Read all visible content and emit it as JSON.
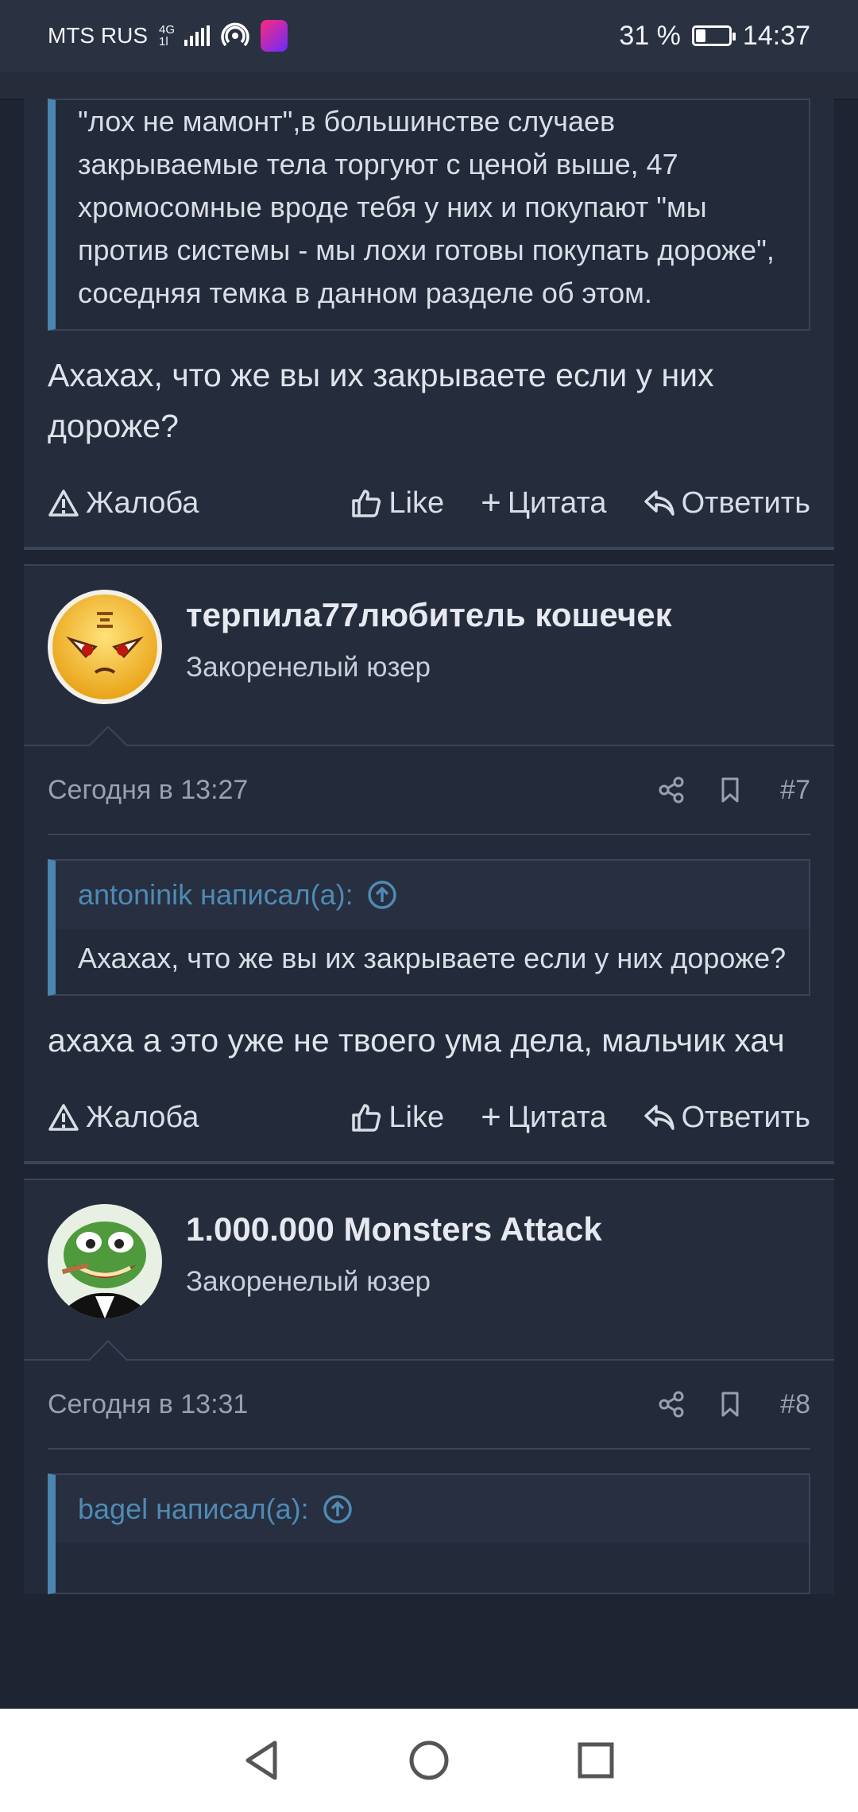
{
  "status_bar": {
    "carrier": "MTS RUS",
    "network_top": "4G",
    "network_bottom": "1l",
    "battery_percent": "31 %",
    "battery_level": 0.31,
    "time": "14:37"
  },
  "posts": [
    {
      "quote_text": "\"лох не мамонт\",в большинстве случаев закрываемые тела торгуют с ценой выше, 47 хромосомные вроде тебя у них и покупают \"мы против системы - мы лохи готовы покупать дороже\", соседняя темка в данном разделе об этом.",
      "text": "Ахахах, что же вы их закрываете если у них дороже?",
      "actions": {
        "report": "Жалоба",
        "like": "Like",
        "quote": "Цитата",
        "reply": "Ответить"
      }
    },
    {
      "username": "терпила77любитель кошечек",
      "user_title": "Закоренелый юзер",
      "date": "Сегодня в 13:27",
      "number": "#7",
      "quote_author": "antoninik написал(а):",
      "quote_text": "Ахахах, что же вы их закрываете если у них дороже?",
      "text": "ахаха а это уже не твоего ума дела, мальчик хач",
      "actions": {
        "report": "Жалоба",
        "like": "Like",
        "quote": "Цитата",
        "reply": "Ответить"
      }
    },
    {
      "username": "1.000.000 Monsters Attack",
      "user_title": "Закоренелый юзер",
      "date": "Сегодня в 13:31",
      "number": "#8",
      "quote_author": "bagel написал(а):"
    }
  ],
  "colors": {
    "background": "#1f2433",
    "post": "#252c3c",
    "accent": "#4b86b0"
  },
  "icons": [
    "warning-icon",
    "thumbs-up-icon",
    "plus-icon",
    "reply-icon",
    "share-icon",
    "bookmark-icon",
    "arrow-up-circle-icon",
    "back-icon",
    "home-icon",
    "recents-icon"
  ]
}
